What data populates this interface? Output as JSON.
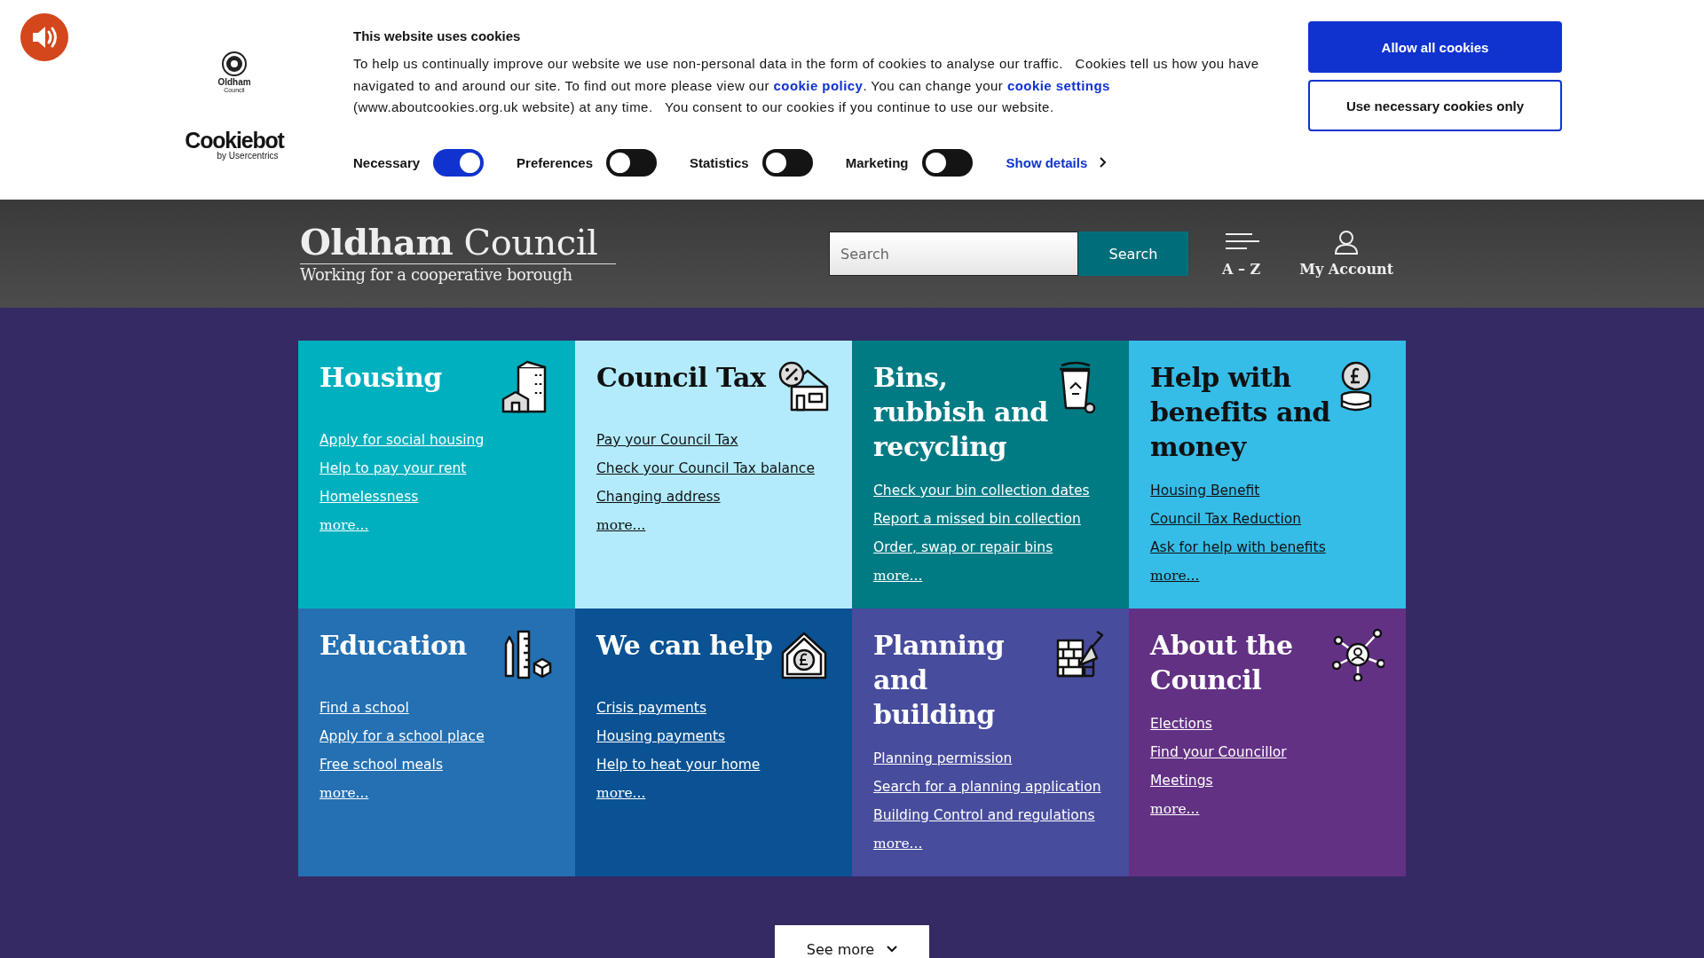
{
  "cookie_banner": {
    "owner_logo": {
      "name": "Oldham",
      "sub": "Council"
    },
    "provider_logo": {
      "name": "Cookiebot",
      "sub": "by Usercentrics"
    },
    "title": "This website uses cookies",
    "body": [
      {
        "kind": "text",
        "text": "To help us continually improve our website we use non-personal data in the form of cookies to analyse our traffic.   Cookies tell us how you have navigated to and around our site. To find out more please view our "
      },
      {
        "kind": "link",
        "text": "cookie policy"
      },
      {
        "kind": "text",
        "text": ". You can change your "
      },
      {
        "kind": "link",
        "text": "cookie settings"
      },
      {
        "kind": "text",
        "text": " (www.aboutcookies.org.uk website) at any time.   You consent to our cookies if you continue to use our website."
      }
    ],
    "toggles": [
      {
        "label": "Necessary",
        "on": true
      },
      {
        "label": "Preferences",
        "on": false
      },
      {
        "label": "Statistics",
        "on": false
      },
      {
        "label": "Marketing",
        "on": false
      }
    ],
    "show_details": "Show details",
    "buttons": [
      {
        "label": "Allow all cookies",
        "kind": "primary"
      },
      {
        "label": "Use necessary cookies only",
        "kind": "outline"
      }
    ]
  },
  "header": {
    "logo_title": "**Oldham** Council",
    "tagline": "Working for a cooperative borough",
    "search": {
      "placeholder": "Search",
      "button": "Search"
    },
    "nav": [
      {
        "label": "A – Z",
        "kind": "lines"
      },
      {
        "label": "My Account",
        "kind": "person"
      }
    ]
  },
  "tiles": [
    {
      "title": "Housing",
      "color": "#00b0bf",
      "kind": "buildings",
      "links": [
        "Apply for social housing",
        "Help to pay your rent",
        "Homelessness"
      ],
      "more": "more..."
    },
    {
      "title": "Council Tax",
      "color": "#b3ebfc",
      "kind": "house-percent",
      "links": [
        "Pay your Council Tax",
        "Check your Council Tax balance",
        "Changing address"
      ],
      "more": "more..."
    },
    {
      "title": "Bins, rubbish and recycling",
      "color": "#007b84",
      "kind": "bin",
      "links": [
        "Check your bin collection dates",
        "Report a missed bin collection",
        "Order, swap or repair bins"
      ],
      "more": "more..."
    },
    {
      "title": "Help with benefits and money",
      "color": "#35bde8",
      "kind": "coins",
      "links": [
        "Housing Benefit",
        "Council Tax Reduction",
        "Ask for help with benefits"
      ],
      "more": "more..."
    },
    {
      "title": "Education",
      "color": "#2470b3",
      "kind": "ruler",
      "links": [
        "Find a school",
        "Apply for a school place",
        "Free school meals"
      ],
      "more": "more..."
    },
    {
      "title": "We can help",
      "color": "#0a5293",
      "kind": "house-pound",
      "links": [
        "Crisis payments",
        "Housing payments",
        "Help to heat your home"
      ],
      "more": "more..."
    },
    {
      "title": "Planning and building",
      "color": "#484c9d",
      "kind": "bricks",
      "links": [
        "Planning permission",
        "Search for a planning application",
        "Building Control and regulations"
      ],
      "more": "more..."
    },
    {
      "title": "About the Council",
      "color": "#633184",
      "kind": "network",
      "links": [
        "Elections",
        "Find your Councillor",
        "Meetings"
      ],
      "more": "more..."
    }
  ],
  "see_more": "See more"
}
